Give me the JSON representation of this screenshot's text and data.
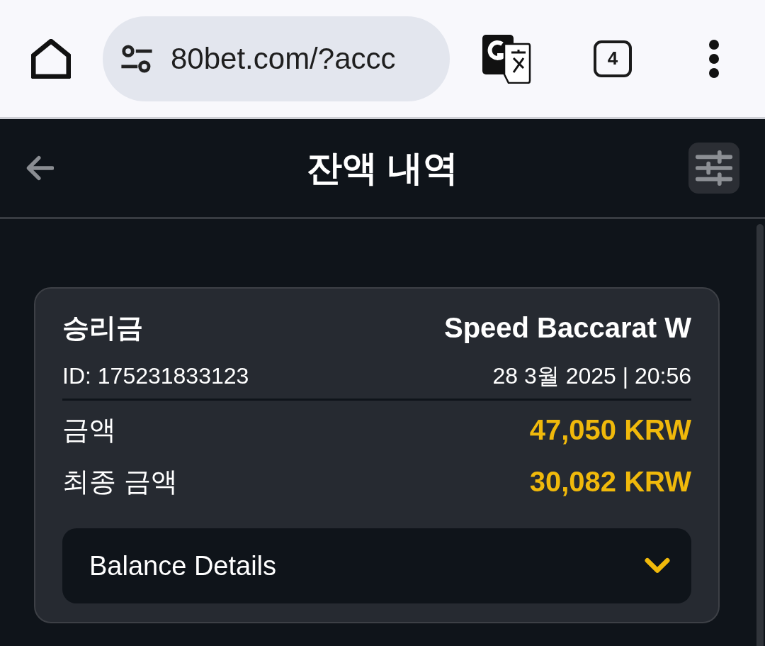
{
  "browser": {
    "url": "80bet.com/?accc",
    "tab_count": "4"
  },
  "header": {
    "title": "잔액 내역"
  },
  "transactions": [
    {
      "type": "승리금",
      "game": "Speed Baccarat W",
      "id": "ID: 175231833123",
      "date": "28 3월 2025 | 20:56",
      "amounts": [
        {
          "label": "금액",
          "value": "47,050 KRW"
        },
        {
          "label": "최종 금액",
          "value": "30,082 KRW"
        }
      ],
      "details": {
        "label": "Balance Details",
        "expanded": false
      }
    }
  ]
}
